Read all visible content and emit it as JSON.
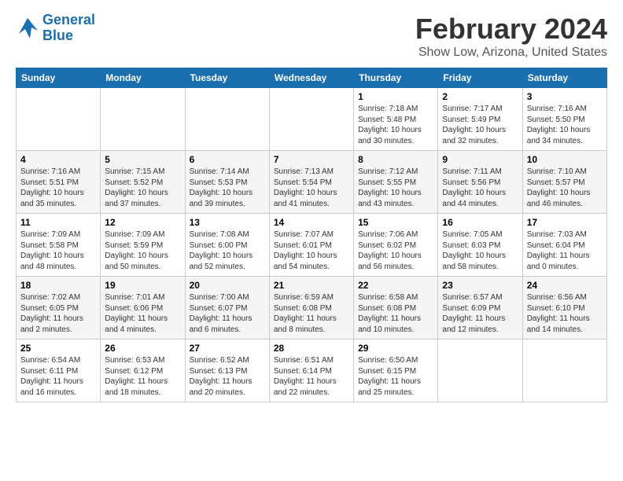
{
  "logo": {
    "line1": "General",
    "line2": "Blue"
  },
  "title": "February 2024",
  "subtitle": "Show Low, Arizona, United States",
  "days_of_week": [
    "Sunday",
    "Monday",
    "Tuesday",
    "Wednesday",
    "Thursday",
    "Friday",
    "Saturday"
  ],
  "weeks": [
    [
      {
        "day": "",
        "info": ""
      },
      {
        "day": "",
        "info": ""
      },
      {
        "day": "",
        "info": ""
      },
      {
        "day": "",
        "info": ""
      },
      {
        "day": "1",
        "info": "Sunrise: 7:18 AM\nSunset: 5:48 PM\nDaylight: 10 hours\nand 30 minutes."
      },
      {
        "day": "2",
        "info": "Sunrise: 7:17 AM\nSunset: 5:49 PM\nDaylight: 10 hours\nand 32 minutes."
      },
      {
        "day": "3",
        "info": "Sunrise: 7:16 AM\nSunset: 5:50 PM\nDaylight: 10 hours\nand 34 minutes."
      }
    ],
    [
      {
        "day": "4",
        "info": "Sunrise: 7:16 AM\nSunset: 5:51 PM\nDaylight: 10 hours\nand 35 minutes."
      },
      {
        "day": "5",
        "info": "Sunrise: 7:15 AM\nSunset: 5:52 PM\nDaylight: 10 hours\nand 37 minutes."
      },
      {
        "day": "6",
        "info": "Sunrise: 7:14 AM\nSunset: 5:53 PM\nDaylight: 10 hours\nand 39 minutes."
      },
      {
        "day": "7",
        "info": "Sunrise: 7:13 AM\nSunset: 5:54 PM\nDaylight: 10 hours\nand 41 minutes."
      },
      {
        "day": "8",
        "info": "Sunrise: 7:12 AM\nSunset: 5:55 PM\nDaylight: 10 hours\nand 43 minutes."
      },
      {
        "day": "9",
        "info": "Sunrise: 7:11 AM\nSunset: 5:56 PM\nDaylight: 10 hours\nand 44 minutes."
      },
      {
        "day": "10",
        "info": "Sunrise: 7:10 AM\nSunset: 5:57 PM\nDaylight: 10 hours\nand 46 minutes."
      }
    ],
    [
      {
        "day": "11",
        "info": "Sunrise: 7:09 AM\nSunset: 5:58 PM\nDaylight: 10 hours\nand 48 minutes."
      },
      {
        "day": "12",
        "info": "Sunrise: 7:09 AM\nSunset: 5:59 PM\nDaylight: 10 hours\nand 50 minutes."
      },
      {
        "day": "13",
        "info": "Sunrise: 7:08 AM\nSunset: 6:00 PM\nDaylight: 10 hours\nand 52 minutes."
      },
      {
        "day": "14",
        "info": "Sunrise: 7:07 AM\nSunset: 6:01 PM\nDaylight: 10 hours\nand 54 minutes."
      },
      {
        "day": "15",
        "info": "Sunrise: 7:06 AM\nSunset: 6:02 PM\nDaylight: 10 hours\nand 56 minutes."
      },
      {
        "day": "16",
        "info": "Sunrise: 7:05 AM\nSunset: 6:03 PM\nDaylight: 10 hours\nand 58 minutes."
      },
      {
        "day": "17",
        "info": "Sunrise: 7:03 AM\nSunset: 6:04 PM\nDaylight: 11 hours\nand 0 minutes."
      }
    ],
    [
      {
        "day": "18",
        "info": "Sunrise: 7:02 AM\nSunset: 6:05 PM\nDaylight: 11 hours\nand 2 minutes."
      },
      {
        "day": "19",
        "info": "Sunrise: 7:01 AM\nSunset: 6:06 PM\nDaylight: 11 hours\nand 4 minutes."
      },
      {
        "day": "20",
        "info": "Sunrise: 7:00 AM\nSunset: 6:07 PM\nDaylight: 11 hours\nand 6 minutes."
      },
      {
        "day": "21",
        "info": "Sunrise: 6:59 AM\nSunset: 6:08 PM\nDaylight: 11 hours\nand 8 minutes."
      },
      {
        "day": "22",
        "info": "Sunrise: 6:58 AM\nSunset: 6:08 PM\nDaylight: 11 hours\nand 10 minutes."
      },
      {
        "day": "23",
        "info": "Sunrise: 6:57 AM\nSunset: 6:09 PM\nDaylight: 11 hours\nand 12 minutes."
      },
      {
        "day": "24",
        "info": "Sunrise: 6:56 AM\nSunset: 6:10 PM\nDaylight: 11 hours\nand 14 minutes."
      }
    ],
    [
      {
        "day": "25",
        "info": "Sunrise: 6:54 AM\nSunset: 6:11 PM\nDaylight: 11 hours\nand 16 minutes."
      },
      {
        "day": "26",
        "info": "Sunrise: 6:53 AM\nSunset: 6:12 PM\nDaylight: 11 hours\nand 18 minutes."
      },
      {
        "day": "27",
        "info": "Sunrise: 6:52 AM\nSunset: 6:13 PM\nDaylight: 11 hours\nand 20 minutes."
      },
      {
        "day": "28",
        "info": "Sunrise: 6:51 AM\nSunset: 6:14 PM\nDaylight: 11 hours\nand 22 minutes."
      },
      {
        "day": "29",
        "info": "Sunrise: 6:50 AM\nSunset: 6:15 PM\nDaylight: 11 hours\nand 25 minutes."
      },
      {
        "day": "",
        "info": ""
      },
      {
        "day": "",
        "info": ""
      }
    ]
  ]
}
